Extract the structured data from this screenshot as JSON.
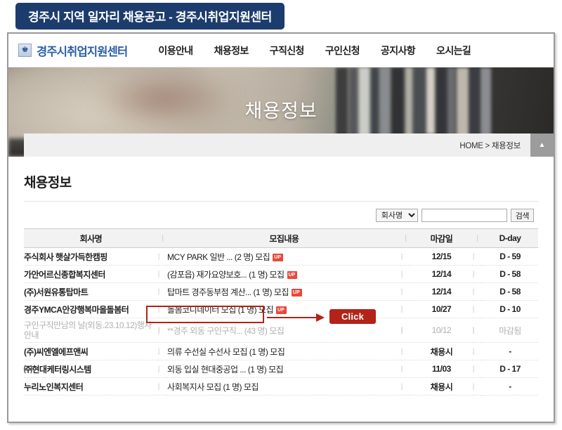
{
  "banner": {
    "title": "경주시 지역 일자리 채용공고 - 경주시취업지원센터"
  },
  "site_nav": {
    "brand": "경주시취업지원센터",
    "brand_emblem": "emblem-icon",
    "links": [
      {
        "label": "이용안내"
      },
      {
        "label": "채용정보"
      },
      {
        "label": "구직신청"
      },
      {
        "label": "구인신청"
      },
      {
        "label": "공지사항"
      },
      {
        "label": "오시는길"
      }
    ]
  },
  "hero": {
    "title": "채용정보"
  },
  "breadcrumb": {
    "text": "HOME > 채용정보",
    "top_button": "▲"
  },
  "content": {
    "page_title": "채용정보"
  },
  "search": {
    "filter_selected": "회사명",
    "filter_options": [
      "회사명"
    ],
    "input_value": "",
    "input_placeholder": "",
    "button_label": "검색"
  },
  "table": {
    "headers": {
      "company": "회사명",
      "description": "모집내용",
      "deadline": "마감일",
      "dday": "D-day",
      "separator": "|"
    },
    "rows": [
      {
        "company": "주식회사 햇살가득한캠핑",
        "description": "MCY PARK 일반 ... (2 명) 모집",
        "badge": "UP",
        "deadline": "12/15",
        "dday": "D - 59",
        "closed": false
      },
      {
        "company": "가안어르신종합복지센터",
        "description": "(감포읍) 재가요양보호... (1 명) 모집",
        "badge": "UP",
        "deadline": "12/14",
        "dday": "D - 58",
        "closed": false
      },
      {
        "company": "(주)서원유통탑마트",
        "description": "탑마트 경주동부점 계산... (1 명) 모집",
        "badge": "UP",
        "deadline": "12/14",
        "dday": "D - 58",
        "closed": false
      },
      {
        "company": "경주YMCA안강행복마을돌봄터",
        "description": "돌봄코디네이터 모집 (1 명) 모집",
        "badge": "UP",
        "deadline": "10/27",
        "dday": "D - 10",
        "closed": false
      },
      {
        "company": "구인구직만남의 날(외동.23.10.12)행사안내",
        "description": "**경주 외동 구인구직... (43 명) 모집",
        "badge": "",
        "deadline": "10/12",
        "dday": "마감됨",
        "closed": true
      },
      {
        "company": "(주)씨엔엘에프앤씨",
        "description": "의류 수선실 수선사 모집 (1 명) 모집",
        "badge": "",
        "deadline": "채용시",
        "dday": "-",
        "closed": false
      },
      {
        "company": "㈜현대케터링시스템",
        "description": "외동 입실 현대중공업 ... (1 명) 모집",
        "badge": "",
        "deadline": "11/03",
        "dday": "D - 17",
        "closed": false
      },
      {
        "company": "누리노인복지센터",
        "description": "사회복지사 모집 (1 명) 모집",
        "badge": "",
        "deadline": "채용시",
        "dday": "-",
        "closed": false
      }
    ]
  },
  "annotations": {
    "click_button_label": "Click",
    "highlight_color": "#b32317"
  }
}
